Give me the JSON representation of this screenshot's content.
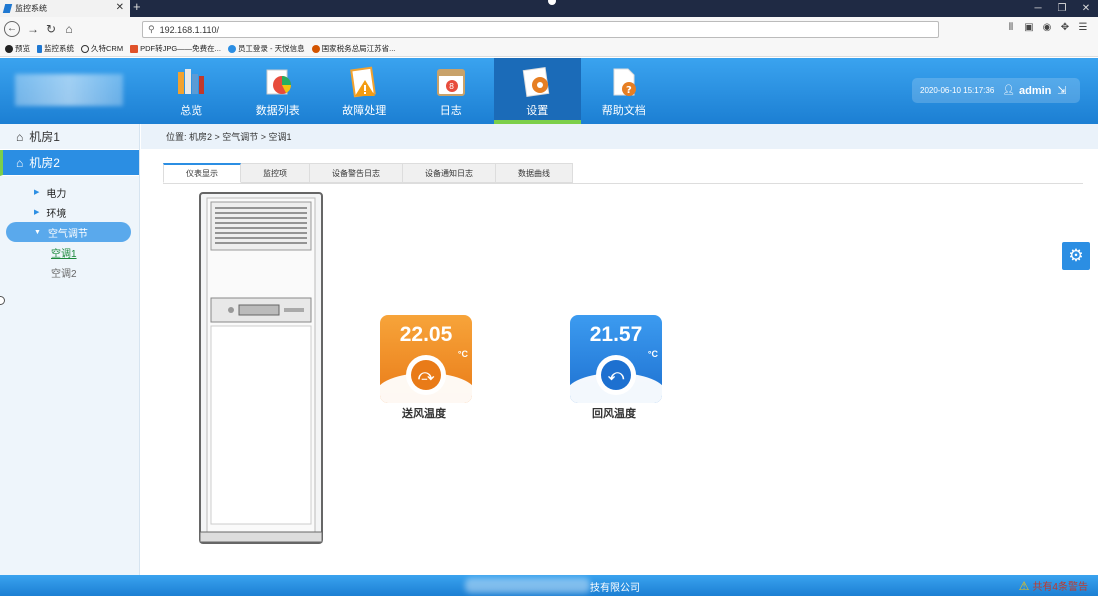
{
  "browser": {
    "tab_title": "监控系统",
    "url": "192.168.1.110/",
    "bookmarks": [
      "预览",
      "监控系统",
      "久特CRM",
      "PDF转JPG——免费在...",
      "员工登录 - 天悦信息",
      "国家税务总局江苏省..."
    ]
  },
  "header": {
    "menu": [
      {
        "label": "总览",
        "icon": "books-icon"
      },
      {
        "label": "数据列表",
        "icon": "chart-icon"
      },
      {
        "label": "故障处理",
        "icon": "warning-doc-icon"
      },
      {
        "label": "日志",
        "icon": "calendar-icon"
      },
      {
        "label": "设置",
        "icon": "gear-doc-icon",
        "active": true
      },
      {
        "label": "帮助文档",
        "icon": "help-doc-icon"
      }
    ],
    "datetime": "2020-06-10  15:17:36",
    "username": "admin"
  },
  "sidebar": {
    "rooms": [
      {
        "label": "机房1",
        "active": false
      },
      {
        "label": "机房2",
        "active": true
      }
    ],
    "subitems": [
      "电力",
      "环境",
      "空气调节"
    ],
    "leaves": [
      "空调1",
      "空调2"
    ]
  },
  "breadcrumb": {
    "text": "位置:  机房2 > 空气调节 > 空调1"
  },
  "tabs": [
    "仪表显示",
    "监控项",
    "设备警告日志",
    "设备通知日志",
    "数据曲线"
  ],
  "gauges": [
    {
      "value": "22.05",
      "unit": "°C",
      "label": "送风温度",
      "color": "#f08a24"
    },
    {
      "value": "21.57",
      "unit": "°C",
      "label": "回风温度",
      "color": "#2f86e0"
    }
  ],
  "footer": {
    "company_suffix": "技有限公司",
    "alert": "共有4条警告"
  }
}
